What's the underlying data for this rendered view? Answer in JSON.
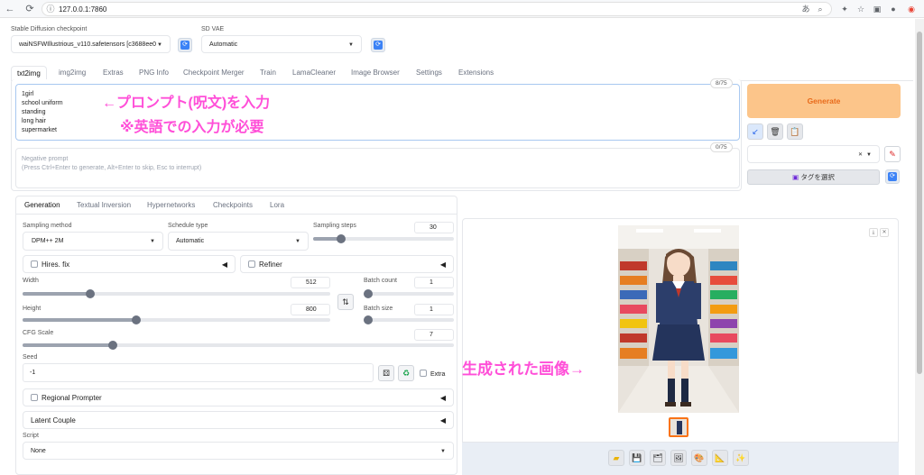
{
  "browser": {
    "url": "127.0.0.1:7860"
  },
  "top": {
    "checkpoint_label": "Stable Diffusion checkpoint",
    "checkpoint_value": "waiNSFWIllustrious_v110.safetensors [c3688ee0",
    "vae_label": "SD VAE",
    "vae_value": "Automatic"
  },
  "tabs": [
    "txt2img",
    "img2img",
    "Extras",
    "PNG Info",
    "Checkpoint Merger",
    "Train",
    "LamaCleaner",
    "Image Browser",
    "Settings",
    "Extensions"
  ],
  "prompt": {
    "lines": [
      "1girl",
      "school uniform",
      "standing",
      "long hair",
      "supermarket"
    ],
    "counter": "8/75",
    "negative_placeholder_1": "Negative prompt",
    "negative_placeholder_2": "(Press Ctrl+Enter to generate, Alt+Enter to skip, Esc to interrupt)",
    "negative_counter": "0/75"
  },
  "annotations": {
    "prompt_line1": "←プロンプト(呪文)を入力",
    "prompt_line2": "※英語での入力が必要",
    "image": "生成された画像→"
  },
  "right": {
    "generate": "Generate",
    "tag_button": "タグを選択"
  },
  "subtabs": [
    "Generation",
    "Textual Inversion",
    "Hypernetworks",
    "Checkpoints",
    "Lora"
  ],
  "gen": {
    "sampling_method_label": "Sampling method",
    "sampling_method": "DPM++ 2M",
    "schedule_label": "Schedule type",
    "schedule": "Automatic",
    "steps_label": "Sampling steps",
    "steps": "30",
    "steps_fraction": 0.2,
    "hires": "Hires. fix",
    "refiner": "Refiner",
    "width_label": "Width",
    "width": "512",
    "width_fraction": 0.22,
    "height_label": "Height",
    "height": "800",
    "height_fraction": 0.37,
    "batch_count_label": "Batch count",
    "batch_count": "1",
    "batch_size_label": "Batch size",
    "batch_size": "1",
    "cfg_label": "CFG Scale",
    "cfg": "7",
    "cfg_fraction": 0.21,
    "seed_label": "Seed",
    "seed": "-1",
    "extra": "Extra",
    "regional": "Regional Prompter",
    "latent": "Latent Couple",
    "script_label": "Script",
    "script": "None"
  },
  "colors": {
    "generate_bg": "#fcc58a",
    "generate_text": "#e86a1a",
    "annotation": "#ff4fd8",
    "accent_blue": "#3b82f6"
  }
}
